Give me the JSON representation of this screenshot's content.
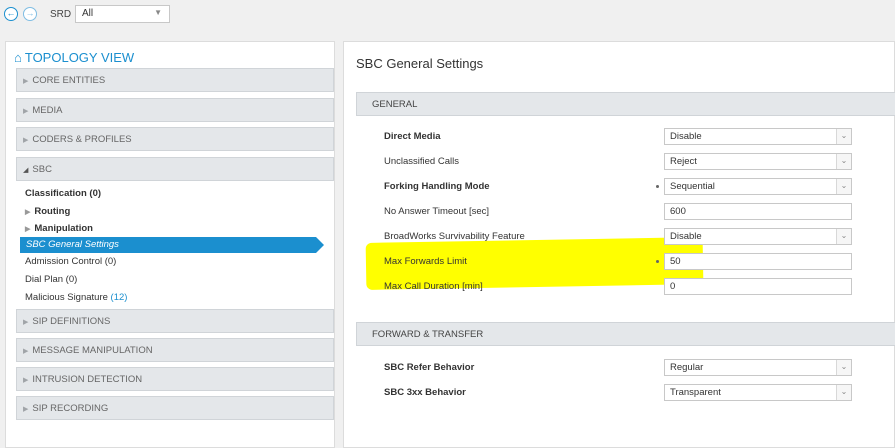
{
  "toolbar": {
    "back_icon": "arrow-left-circle-icon",
    "forward_icon": "arrow-right-circle-icon",
    "srd_label": "SRD",
    "srd_value": "All"
  },
  "sidebar": {
    "title": "TOPOLOGY VIEW",
    "sections": {
      "core": "CORE ENTITIES",
      "media": "MEDIA",
      "coders": "CODERS & PROFILES",
      "sbc": "SBC",
      "sip_def": "SIP DEFINITIONS",
      "msg_manip": "MESSAGE MANIPULATION",
      "intrusion": "INTRUSION DETECTION",
      "sip_rec": "SIP RECORDING"
    },
    "sbc_items": {
      "classification": "Classification (0)",
      "routing": "Routing",
      "manipulation": "Manipulation",
      "general_settings": "SBC General Settings",
      "admission": "Admission Control (0)",
      "dial_plan": "Dial Plan (0)",
      "malicious_label": "Malicious Signature",
      "malicious_count": "(12)"
    }
  },
  "main": {
    "title": "SBC General Settings",
    "general": {
      "header": "GENERAL",
      "direct_media_label": "Direct Media",
      "direct_media_value": "Disable",
      "unclassified_label": "Unclassified Calls",
      "unclassified_value": "Reject",
      "forking_label": "Forking Handling Mode",
      "forking_value": "Sequential",
      "no_answer_label": "No Answer Timeout [sec]",
      "no_answer_value": "600",
      "broadworks_label": "BroadWorks Survivability Feature",
      "broadworks_value": "Disable",
      "max_fwd_label": "Max Forwards Limit",
      "max_fwd_value": "50",
      "max_dur_label": "Max Call Duration [min]",
      "max_dur_value": "0"
    },
    "forward": {
      "header": "FORWARD & TRANSFER",
      "refer_label": "SBC Refer Behavior",
      "refer_value": "Regular",
      "threexx_label": "SBC 3xx Behavior",
      "threexx_value": "Transparent"
    }
  },
  "colors": {
    "accent": "#1b8fcf",
    "highlight": "#ffff00"
  }
}
